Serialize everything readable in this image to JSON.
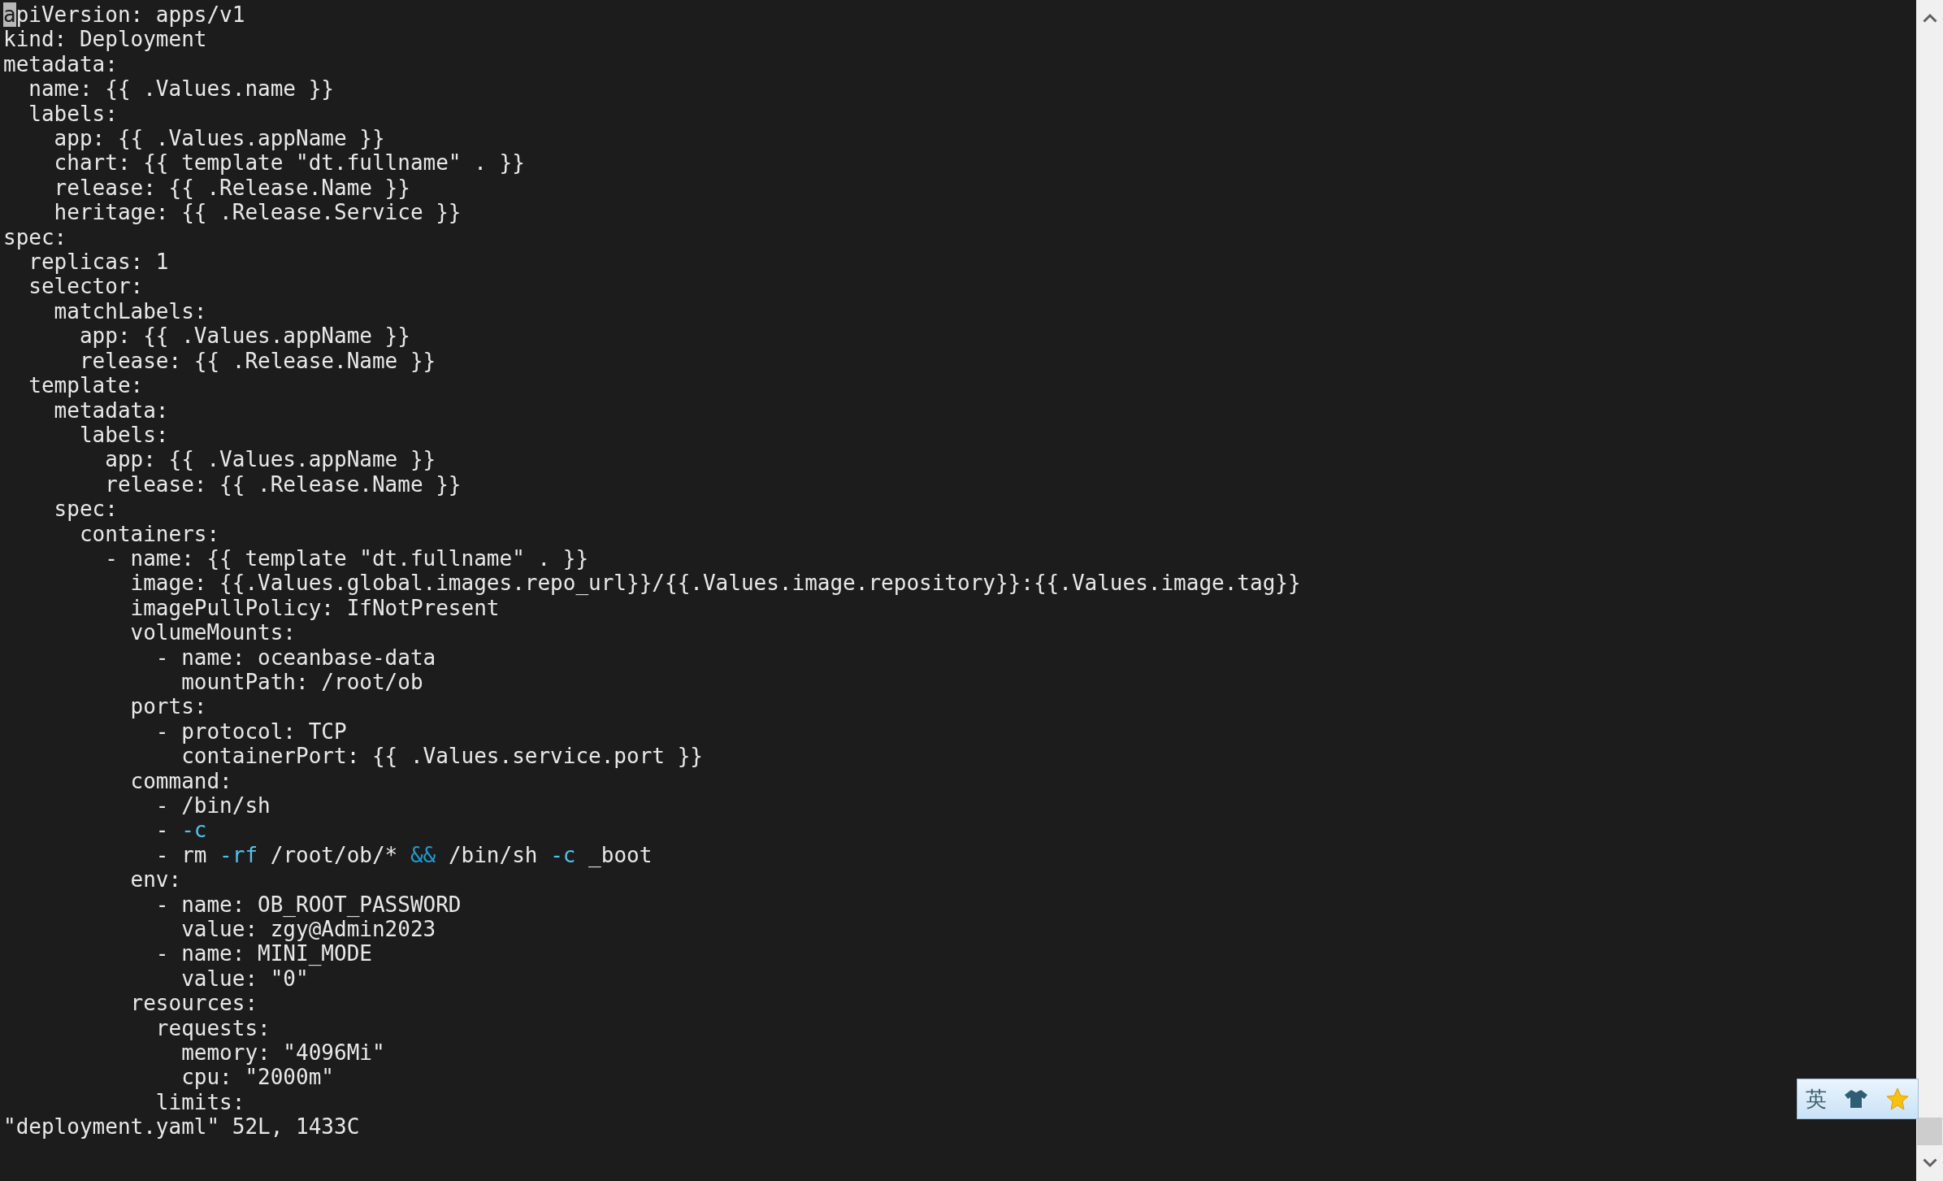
{
  "editor": {
    "lines": [
      [
        {
          "kind": "cursor",
          "text": "a"
        },
        {
          "kind": "text",
          "text": "piVersion: apps/v1"
        }
      ],
      [
        {
          "kind": "text",
          "text": "kind: Deployment"
        }
      ],
      [
        {
          "kind": "text",
          "text": "metadata:"
        }
      ],
      [
        {
          "kind": "text",
          "text": "  name: {{ .Values.name }}"
        }
      ],
      [
        {
          "kind": "text",
          "text": "  labels:"
        }
      ],
      [
        {
          "kind": "text",
          "text": "    app: {{ .Values.appName }}"
        }
      ],
      [
        {
          "kind": "text",
          "text": "    chart: {{ template \"dt.fullname\" . }}"
        }
      ],
      [
        {
          "kind": "text",
          "text": "    release: {{ .Release.Name }}"
        }
      ],
      [
        {
          "kind": "text",
          "text": "    heritage: {{ .Release.Service }}"
        }
      ],
      [
        {
          "kind": "text",
          "text": "spec:"
        }
      ],
      [
        {
          "kind": "text",
          "text": "  replicas: 1"
        }
      ],
      [
        {
          "kind": "text",
          "text": "  selector:"
        }
      ],
      [
        {
          "kind": "text",
          "text": "    matchLabels:"
        }
      ],
      [
        {
          "kind": "text",
          "text": "      app: {{ .Values.appName }}"
        }
      ],
      [
        {
          "kind": "text",
          "text": "      release: {{ .Release.Name }}"
        }
      ],
      [
        {
          "kind": "text",
          "text": "  template:"
        }
      ],
      [
        {
          "kind": "text",
          "text": "    metadata:"
        }
      ],
      [
        {
          "kind": "text",
          "text": "      labels:"
        }
      ],
      [
        {
          "kind": "text",
          "text": "        app: {{ .Values.appName }}"
        }
      ],
      [
        {
          "kind": "text",
          "text": "        release: {{ .Release.Name }}"
        }
      ],
      [
        {
          "kind": "text",
          "text": "    spec:"
        }
      ],
      [
        {
          "kind": "text",
          "text": "      containers:"
        }
      ],
      [
        {
          "kind": "text",
          "text": "        - name: {{ template \"dt.fullname\" . }}"
        }
      ],
      [
        {
          "kind": "text",
          "text": "          image: {{.Values.global.images.repo_url}}/{{.Values.image.repository}}:{{.Values.image.tag}}"
        }
      ],
      [
        {
          "kind": "text",
          "text": "          imagePullPolicy: IfNotPresent"
        }
      ],
      [
        {
          "kind": "text",
          "text": "          volumeMounts:"
        }
      ],
      [
        {
          "kind": "text",
          "text": "            - name: oceanbase-data"
        }
      ],
      [
        {
          "kind": "text",
          "text": "              mountPath: /root/ob"
        }
      ],
      [
        {
          "kind": "text",
          "text": "          ports:"
        }
      ],
      [
        {
          "kind": "text",
          "text": "            - protocol: TCP"
        }
      ],
      [
        {
          "kind": "text",
          "text": "              containerPort: {{ .Values.service.port }}"
        }
      ],
      [
        {
          "kind": "text",
          "text": "          command:"
        }
      ],
      [
        {
          "kind": "text",
          "text": "            - /bin/sh"
        }
      ],
      [
        {
          "kind": "text",
          "text": "            - "
        },
        {
          "kind": "flag",
          "text": "-c"
        }
      ],
      [
        {
          "kind": "text",
          "text": "            - rm "
        },
        {
          "kind": "flag",
          "text": "-rf"
        },
        {
          "kind": "text",
          "text": " /root/ob/* "
        },
        {
          "kind": "operator",
          "text": "&&"
        },
        {
          "kind": "text",
          "text": " /bin/sh "
        },
        {
          "kind": "flag",
          "text": "-c"
        },
        {
          "kind": "text",
          "text": " _boot"
        }
      ],
      [
        {
          "kind": "text",
          "text": "          env:"
        }
      ],
      [
        {
          "kind": "text",
          "text": "            - name: OB_ROOT_PASSWORD"
        }
      ],
      [
        {
          "kind": "text",
          "text": "              value: zgy@Admin2023"
        }
      ],
      [
        {
          "kind": "text",
          "text": "            - name: MINI_MODE"
        }
      ],
      [
        {
          "kind": "text",
          "text": "              value: \"0\""
        }
      ],
      [
        {
          "kind": "text",
          "text": "          resources:"
        }
      ],
      [
        {
          "kind": "text",
          "text": "            requests:"
        }
      ],
      [
        {
          "kind": "text",
          "text": "              memory: \"4096Mi\""
        }
      ],
      [
        {
          "kind": "text",
          "text": "              cpu: \"2000m\""
        }
      ],
      [
        {
          "kind": "text",
          "text": "            limits:"
        }
      ]
    ],
    "status_line": "\"deployment.yaml\" 52L, 1433C"
  },
  "ime_toolbar": {
    "language": "英"
  }
}
